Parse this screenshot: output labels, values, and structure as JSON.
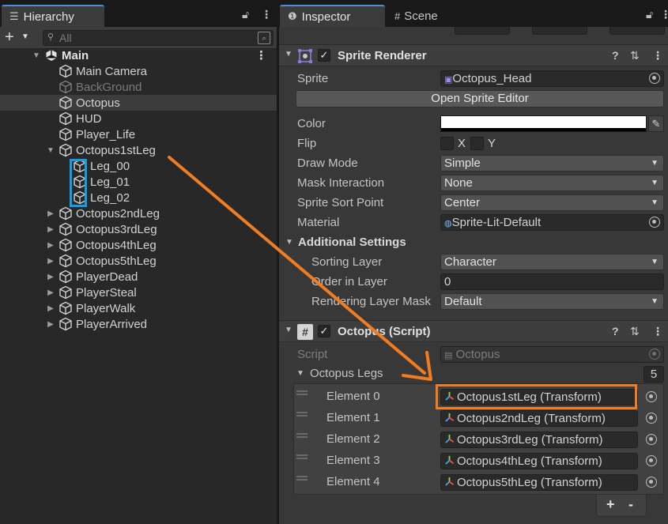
{
  "hierarchy": {
    "tab_label": "Hierarchy",
    "search_placeholder": "All",
    "rows": [
      {
        "label": "Main",
        "depth": 0,
        "expanded": true,
        "is_scene": true,
        "bold": true
      },
      {
        "label": "Main Camera",
        "depth": 1
      },
      {
        "label": "BackGround",
        "depth": 1,
        "dim": true
      },
      {
        "label": "Octopus",
        "depth": 1,
        "selected": true
      },
      {
        "label": "HUD",
        "depth": 1
      },
      {
        "label": "Player_Life",
        "depth": 1
      },
      {
        "label": "Octopus1stLeg",
        "depth": 1,
        "expanded": true
      },
      {
        "label": "Leg_00",
        "depth": 2
      },
      {
        "label": "Leg_01",
        "depth": 2
      },
      {
        "label": "Leg_02",
        "depth": 2
      },
      {
        "label": "Octopus2ndLeg",
        "depth": 1,
        "collapsed": true
      },
      {
        "label": "Octopus3rdLeg",
        "depth": 1,
        "collapsed": true
      },
      {
        "label": "Octopus4thLeg",
        "depth": 1,
        "collapsed": true
      },
      {
        "label": "Octopus5thLeg",
        "depth": 1,
        "collapsed": true
      },
      {
        "label": "PlayerDead",
        "depth": 1,
        "collapsed": true
      },
      {
        "label": "PlayerSteal",
        "depth": 1,
        "collapsed": true
      },
      {
        "label": "PlayerWalk",
        "depth": 1,
        "collapsed": true
      },
      {
        "label": "PlayerArrived",
        "depth": 1,
        "collapsed": true
      }
    ]
  },
  "inspector": {
    "tab_label": "Inspector",
    "scene_tab_label": "Scene",
    "sprite_renderer": {
      "title": "Sprite Renderer",
      "sprite_label": "Sprite",
      "sprite_value": "Octopus_Head",
      "open_editor_button": "Open Sprite Editor",
      "color_label": "Color",
      "flip_label": "Flip",
      "flip_x": "X",
      "flip_y": "Y",
      "draw_mode_label": "Draw Mode",
      "draw_mode_value": "Simple",
      "mask_label": "Mask Interaction",
      "mask_value": "None",
      "sort_point_label": "Sprite Sort Point",
      "sort_point_value": "Center",
      "material_label": "Material",
      "material_value": "Sprite-Lit-Default",
      "additional_label": "Additional Settings",
      "sorting_layer_label": "Sorting Layer",
      "sorting_layer_value": "Character",
      "order_label": "Order in Layer",
      "order_value": "0",
      "rendering_mask_label": "Rendering Layer Mask",
      "rendering_mask_value": "Default"
    },
    "octopus_script": {
      "title": "Octopus (Script)",
      "script_label": "Script",
      "script_value": "Octopus",
      "legs_label": "Octopus Legs",
      "legs_count": "5",
      "elements": [
        {
          "label": "Element 0",
          "value": "Octopus1stLeg (Transform)"
        },
        {
          "label": "Element 1",
          "value": "Octopus2ndLeg (Transform)"
        },
        {
          "label": "Element 2",
          "value": "Octopus3rdLeg (Transform)"
        },
        {
          "label": "Element 3",
          "value": "Octopus4thLeg (Transform)"
        },
        {
          "label": "Element 4",
          "value": "Octopus5thLeg (Transform)"
        }
      ],
      "add_label": "+",
      "remove_label": "-"
    }
  },
  "annotation_colors": {
    "selection_box": "#149ee8",
    "arrow_and_highlight": "#f07d22"
  },
  "icons": [
    "hierarchy-list-icon",
    "lock-icon",
    "kebab-menu-icon",
    "add-icon",
    "search-icon",
    "filter-icon",
    "unity-scene-icon",
    "gameobject-cube-icon",
    "info-icon",
    "grid-icon",
    "sprite-renderer-icon",
    "script-hash-icon",
    "help-icon",
    "preset-sliders-icon",
    "object-picker-icon",
    "eyedropper-icon",
    "sprite-icon",
    "material-icon",
    "transform-axes-icon",
    "script-asset-icon"
  ]
}
